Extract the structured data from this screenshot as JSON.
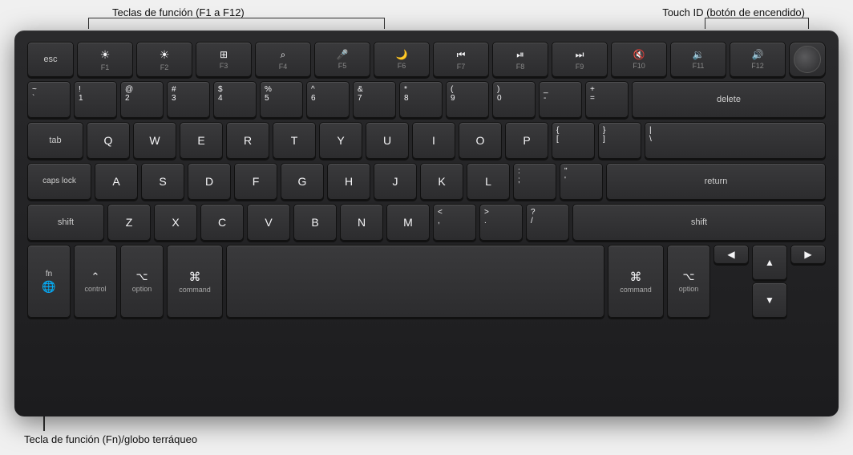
{
  "annotations": {
    "top_left_label": "Teclas de función (F1 a F12)",
    "top_right_label": "Touch ID (botón de encendido)",
    "bottom_left_label": "Tecla de función (Fn)/globo terráqueo"
  },
  "keyboard": {
    "fn_row": [
      {
        "id": "esc",
        "label": "esc",
        "sub": ""
      },
      {
        "id": "f1",
        "label": "",
        "icon": "☀",
        "sub": "F1"
      },
      {
        "id": "f2",
        "label": "",
        "icon": "☀",
        "sub": "F2"
      },
      {
        "id": "f3",
        "label": "",
        "icon": "⊞",
        "sub": "F3"
      },
      {
        "id": "f4",
        "label": "",
        "icon": "🔍",
        "sub": "F4"
      },
      {
        "id": "f5",
        "label": "",
        "icon": "🎤",
        "sub": "F5"
      },
      {
        "id": "f6",
        "label": "",
        "icon": "🌙",
        "sub": "F6"
      },
      {
        "id": "f7",
        "label": "",
        "icon": "«",
        "sub": "F7"
      },
      {
        "id": "f8",
        "label": "",
        "icon": "▶⏸",
        "sub": "F8"
      },
      {
        "id": "f9",
        "label": "",
        "icon": "»",
        "sub": "F9"
      },
      {
        "id": "f10",
        "label": "",
        "icon": "🔇",
        "sub": "F10"
      },
      {
        "id": "f11",
        "label": "",
        "icon": "🔉",
        "sub": "F11"
      },
      {
        "id": "f12",
        "label": "",
        "icon": "🔊",
        "sub": "F12"
      },
      {
        "id": "touchid",
        "label": "",
        "icon": "⏻",
        "sub": ""
      }
    ],
    "num_row": [
      {
        "id": "backtick",
        "top": "~",
        "bot": "`"
      },
      {
        "id": "1",
        "top": "!",
        "bot": "1"
      },
      {
        "id": "2",
        "top": "@",
        "bot": "2"
      },
      {
        "id": "3",
        "top": "#",
        "bot": "3"
      },
      {
        "id": "4",
        "top": "$",
        "bot": "4"
      },
      {
        "id": "5",
        "top": "%",
        "bot": "5"
      },
      {
        "id": "6",
        "top": "^",
        "bot": "6"
      },
      {
        "id": "7",
        "top": "&",
        "bot": "7"
      },
      {
        "id": "8",
        "top": "*",
        "bot": "8"
      },
      {
        "id": "9",
        "top": "(",
        "bot": "9"
      },
      {
        "id": "0",
        "top": ")",
        "bot": "0"
      },
      {
        "id": "minus",
        "top": "_",
        "bot": "-"
      },
      {
        "id": "equals",
        "top": "+",
        "bot": "="
      },
      {
        "id": "delete",
        "label": "delete"
      }
    ],
    "qwerty_row": [
      {
        "id": "tab",
        "label": "tab"
      },
      {
        "id": "q",
        "label": "Q"
      },
      {
        "id": "w",
        "label": "W"
      },
      {
        "id": "e",
        "label": "E"
      },
      {
        "id": "r",
        "label": "R"
      },
      {
        "id": "t",
        "label": "T"
      },
      {
        "id": "y",
        "label": "Y"
      },
      {
        "id": "u",
        "label": "U"
      },
      {
        "id": "i",
        "label": "I"
      },
      {
        "id": "o",
        "label": "O"
      },
      {
        "id": "p",
        "label": "P"
      },
      {
        "id": "bracket_l",
        "top": "{",
        "bot": "["
      },
      {
        "id": "bracket_r",
        "top": "}",
        "bot": "]"
      },
      {
        "id": "backslash",
        "top": "|",
        "bot": "\\"
      }
    ],
    "asdf_row": [
      {
        "id": "capslock",
        "label": "caps lock"
      },
      {
        "id": "a",
        "label": "A"
      },
      {
        "id": "s",
        "label": "S"
      },
      {
        "id": "d",
        "label": "D"
      },
      {
        "id": "f",
        "label": "F"
      },
      {
        "id": "g",
        "label": "G"
      },
      {
        "id": "h",
        "label": "H"
      },
      {
        "id": "j",
        "label": "J"
      },
      {
        "id": "k",
        "label": "K"
      },
      {
        "id": "l",
        "label": "L"
      },
      {
        "id": "semicolon",
        "top": ":",
        "bot": ";"
      },
      {
        "id": "quote",
        "top": "\"",
        "bot": "'"
      },
      {
        "id": "return",
        "label": "return"
      }
    ],
    "zxcv_row": [
      {
        "id": "shift_l",
        "label": "shift"
      },
      {
        "id": "z",
        "label": "Z"
      },
      {
        "id": "x",
        "label": "X"
      },
      {
        "id": "c",
        "label": "C"
      },
      {
        "id": "v",
        "label": "V"
      },
      {
        "id": "b",
        "label": "B"
      },
      {
        "id": "n",
        "label": "N"
      },
      {
        "id": "m",
        "label": "M"
      },
      {
        "id": "comma",
        "top": "<",
        "bot": ","
      },
      {
        "id": "period",
        "top": ">",
        "bot": "."
      },
      {
        "id": "slash",
        "top": "?",
        "bot": "/"
      },
      {
        "id": "shift_r",
        "label": "shift"
      }
    ],
    "bottom_row": [
      {
        "id": "fn_globe",
        "label": "fn",
        "sub": "🌐"
      },
      {
        "id": "control",
        "label": "control",
        "sub": "^"
      },
      {
        "id": "option_l",
        "label": "option",
        "sub": "⌥"
      },
      {
        "id": "command_l",
        "label": "command",
        "sub": "⌘"
      },
      {
        "id": "space",
        "label": ""
      },
      {
        "id": "command_r",
        "label": "command",
        "sub": "⌘"
      },
      {
        "id": "option_r",
        "label": "option",
        "sub": "⌥"
      }
    ]
  }
}
